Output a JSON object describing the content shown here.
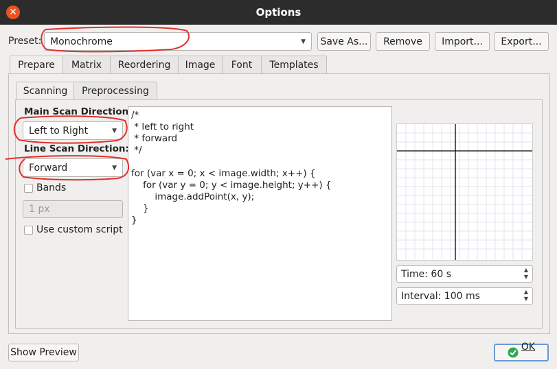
{
  "window": {
    "title": "Options",
    "close_glyph": "✕"
  },
  "preset": {
    "label": "Preset:",
    "value": "Monochrome"
  },
  "buttons": {
    "save_as": "Save As...",
    "remove": "Remove",
    "import": "Import...",
    "export": "Export...",
    "show_preview": "Show Preview",
    "ok": "OK"
  },
  "tabs": [
    "Prepare",
    "Matrix",
    "Reordering",
    "Image",
    "Font",
    "Templates"
  ],
  "subtabs": [
    "Scanning",
    "Preprocessing"
  ],
  "scanning": {
    "main_dir_label": "Main Scan Direction:",
    "main_dir_value": "Left to Right",
    "line_dir_label": "Line Scan Direction:",
    "line_dir_value": "Forward",
    "bands_label": "Bands",
    "bands_value": "1 px",
    "custom_script_label": "Use custom script",
    "script": "/*\n * left to right\n * forward\n */\n\nfor (var x = 0; x < image.width; x++) {\n    for (var y = 0; y < image.height; y++) {\n        image.addPoint(x, y);\n    }\n}"
  },
  "animation": {
    "time": "Time: 60 s",
    "interval": "Interval: 100 ms"
  },
  "colors": {
    "annotation": "#e0302a",
    "ok_icon": "#2fa84f"
  }
}
